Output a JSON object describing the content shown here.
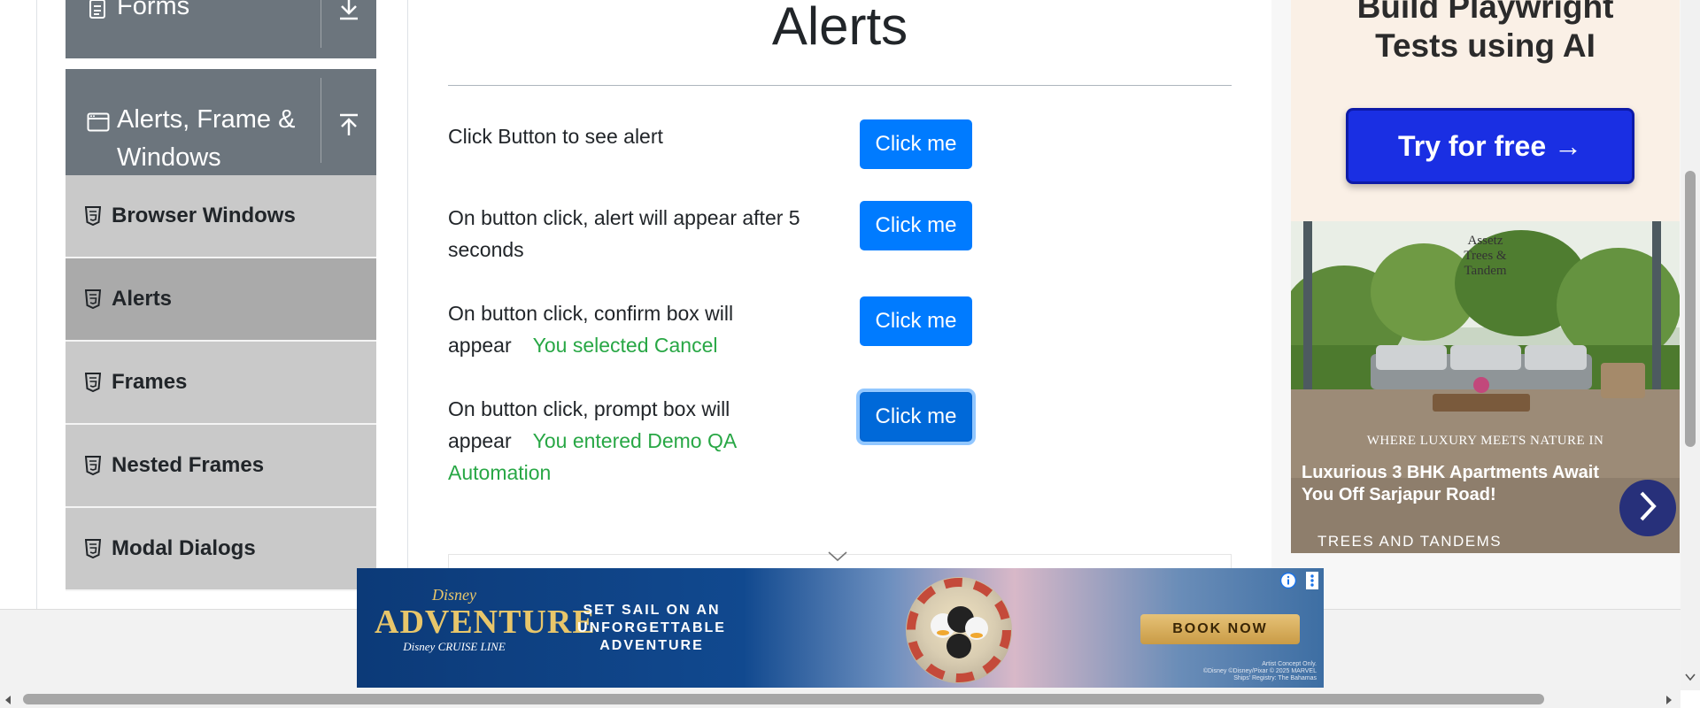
{
  "sidebar": {
    "forms_group": {
      "title": "Forms",
      "icon": "document-icon",
      "toggle_icon": "download-icon"
    },
    "alerts_group": {
      "title_line1": "Alerts, Frame &",
      "title_line2": "Windows",
      "icon": "window-icon",
      "toggle_icon": "upload-icon"
    },
    "items": [
      {
        "label": "Browser Windows",
        "active": false
      },
      {
        "label": "Alerts",
        "active": true
      },
      {
        "label": "Frames",
        "active": false
      },
      {
        "label": "Nested Frames",
        "active": false
      },
      {
        "label": "Modal Dialogs",
        "active": false
      }
    ]
  },
  "main": {
    "title": "Alerts",
    "rows": [
      {
        "text": "Click Button to see alert",
        "button": "Click me",
        "result": ""
      },
      {
        "text_line1": "On button click, alert will appear after 5",
        "text_line2": "seconds",
        "button": "Click me",
        "result": ""
      },
      {
        "text_line1": "On button click, confirm box will",
        "text_line2": "appear",
        "button": "Click me",
        "result": "You selected Cancel"
      },
      {
        "text_line1": "On button click, prompt box will",
        "text_line2": "appear",
        "button": "Click me",
        "result_line1": "You entered Demo QA",
        "result_line2": "Automation"
      }
    ]
  },
  "ads": {
    "top": {
      "headline_line1": "Build Playwright",
      "headline_line2": "Tests using AI",
      "cta": "Try for free →"
    },
    "mid": {
      "brand_line1": "Assetz",
      "brand_line2": "Trees &",
      "brand_line3": "Tandem",
      "tagline": "WHERE LUXURY MEETS NATURE IN",
      "description": "Luxurious 3 BHK Apartments Await You Off Sarjapur Road!",
      "footer": "TREES AND TANDEMS"
    },
    "banner": {
      "logo_top": "Disney",
      "logo_main": "ADVENTURE",
      "logo_sub": "Disney CRUISE LINE",
      "text_line1": "SET SAIL ON AN",
      "text_line2": "UNFORGETTABLE",
      "text_line3": "ADVENTURE",
      "cta": "BOOK NOW",
      "fine_line1": "Artist Concept Only.",
      "fine_line2": "©Disney ©Disney/Pixar © 2025 MARVEL",
      "fine_line3": "Ships' Registry: The Bahamas"
    }
  },
  "colors": {
    "primary_button": "#007bff",
    "result_text": "#28a745",
    "sidebar_header": "#6c757d",
    "sidebar_item": "#c9c9c9",
    "sidebar_item_active": "#aaaaaa"
  }
}
